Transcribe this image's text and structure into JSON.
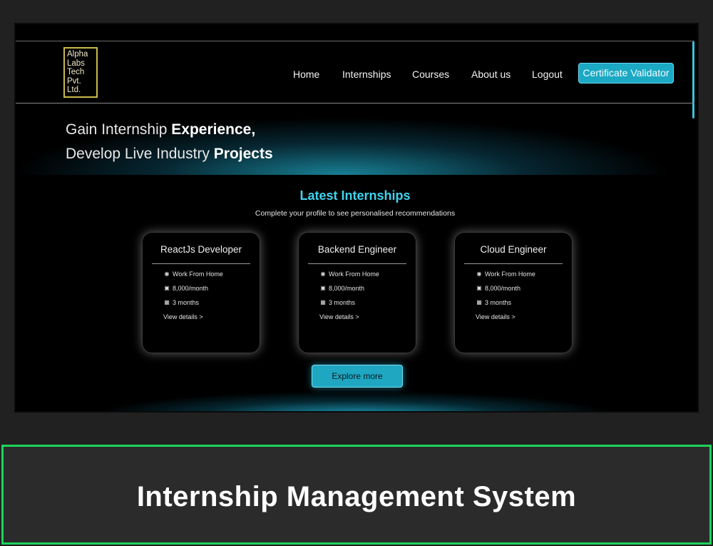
{
  "logo": {
    "lines": [
      "Alpha",
      "Labs",
      "Tech",
      "Pvt.",
      "Ltd."
    ]
  },
  "nav": {
    "items": [
      "Home",
      "Internships",
      "Courses",
      "About us",
      "Logout"
    ],
    "cta": "Certificate Validator"
  },
  "hero": {
    "line1_text": "Gain Internship ",
    "line1_bold": "Experience,",
    "line2_text": "Develop Live Industry ",
    "line2_bold": "Projects"
  },
  "section": {
    "title": "Latest Internships",
    "subtitle": "Complete your profile to see personalised recommendations"
  },
  "cards": [
    {
      "title": "ReactJs Developer",
      "location": "Work From Home",
      "stipend": "8,000/month",
      "duration": "3 months",
      "link": "View details >"
    },
    {
      "title": "Backend Engineer",
      "location": "Work From Home",
      "stipend": "8,000/month",
      "duration": "3 months",
      "link": "View details >"
    },
    {
      "title": "Cloud Engineer",
      "location": "Work From Home",
      "stipend": "8,000/month",
      "duration": "3 months",
      "link": "View details >"
    }
  ],
  "explore": "Explore more",
  "banner": {
    "title": "Internship Management System"
  },
  "colors": {
    "accent": "#1fa7c2",
    "title_accent": "#3fd3ee",
    "banner_border": "#1ed35a"
  },
  "icons": {
    "location": "map-pin-icon",
    "stipend": "money-icon",
    "duration": "calendar-icon"
  }
}
